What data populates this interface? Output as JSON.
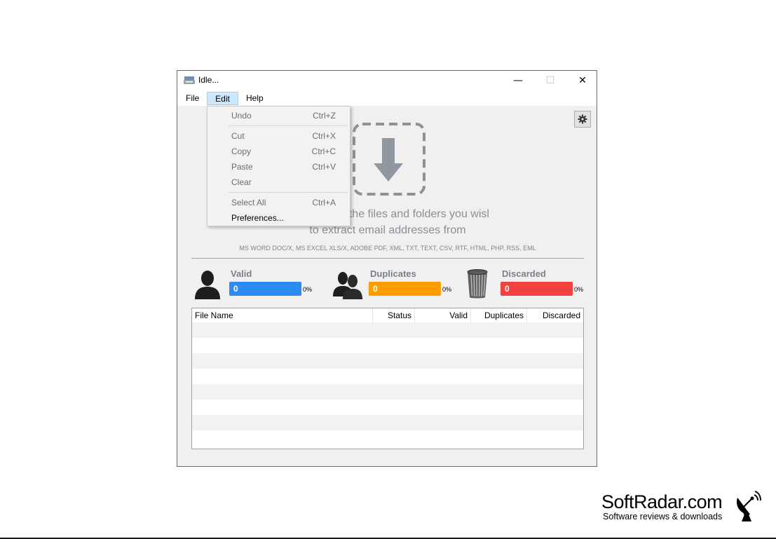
{
  "window": {
    "title": "Idle...",
    "controls": {
      "minimize": "—",
      "maximize": "☐",
      "close": "✕"
    }
  },
  "menubar": {
    "file": "File",
    "edit": "Edit",
    "help": "Help"
  },
  "edit_menu": {
    "undo": {
      "label": "Undo",
      "shortcut": "Ctrl+Z"
    },
    "cut": {
      "label": "Cut",
      "shortcut": "Ctrl+X"
    },
    "copy": {
      "label": "Copy",
      "shortcut": "Ctrl+C"
    },
    "paste": {
      "label": "Paste",
      "shortcut": "Ctrl+V"
    },
    "clear": {
      "label": "Clear"
    },
    "select_all": {
      "label": "Select All",
      "shortcut": "Ctrl+A"
    },
    "preferences": {
      "label": "Preferences..."
    }
  },
  "drop_area": {
    "line1": "d drop the files and folders you wisl",
    "line2": "to extract email addresses from",
    "formats": "MS WORD DOC/X, MS EXCEL XLS/X, ADOBE PDF, XML, TXT, TEXT, CSV, RTF, HTML, PHP, RSS, EML"
  },
  "stats": {
    "valid": {
      "label": "Valid",
      "count": "0",
      "percent": "0%",
      "color": "#2b8bf2"
    },
    "duplicates": {
      "label": "Duplicates",
      "count": "0",
      "percent": "0%",
      "color": "#ff9d00"
    },
    "discarded": {
      "label": "Discarded",
      "count": "0",
      "percent": "0%",
      "color": "#f24141"
    }
  },
  "table": {
    "columns": [
      "File Name",
      "Status",
      "Valid",
      "Duplicates",
      "Discarded"
    ],
    "rows": []
  },
  "watermark": {
    "title": "SoftRadar.com",
    "subtitle": "Software reviews & downloads"
  }
}
